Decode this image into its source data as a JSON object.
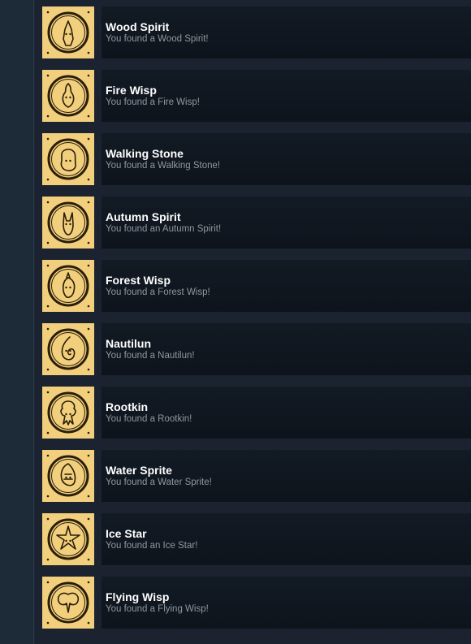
{
  "achievements": [
    {
      "title": "Wood Spirit",
      "description": "You found a Wood Spirit!",
      "icon": "wood-spirit-icon"
    },
    {
      "title": "Fire Wisp",
      "description": "You found a Fire Wisp!",
      "icon": "fire-wisp-icon"
    },
    {
      "title": "Walking Stone",
      "description": "You found a Walking Stone!",
      "icon": "walking-stone-icon"
    },
    {
      "title": "Autumn Spirit",
      "description": "You found an Autumn Spirit!",
      "icon": "autumn-spirit-icon"
    },
    {
      "title": "Forest Wisp",
      "description": "You found a Forest Wisp!",
      "icon": "forest-wisp-icon"
    },
    {
      "title": "Nautilun",
      "description": "You found a Nautilun!",
      "icon": "nautilun-icon"
    },
    {
      "title": "Rootkin",
      "description": "You found a Rootkin!",
      "icon": "rootkin-icon"
    },
    {
      "title": "Water Sprite",
      "description": "You found a Water Sprite!",
      "icon": "water-sprite-icon"
    },
    {
      "title": "Ice Star",
      "description": "You found an Ice Star!",
      "icon": "ice-star-icon"
    },
    {
      "title": "Flying Wisp",
      "description": "You found a Flying Wisp!",
      "icon": "flying-wisp-icon"
    }
  ],
  "colors": {
    "badge_bg": "#f1cf7c",
    "badge_ink": "#2a1e0a",
    "row_bg": "#101720",
    "title": "#ffffff",
    "description": "#8f98a0"
  }
}
